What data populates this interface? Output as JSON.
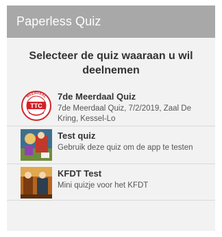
{
  "app_bar": {
    "title": "Paperless Quiz"
  },
  "heading": "Selecteer de quiz waaraan u wil deelnemen",
  "quizzes": [
    {
      "title": "7de Meerdaal Quiz",
      "description": "7de Meerdaal Quiz, 7/2/2019, Zaal De Kring, Kessel-Lo",
      "logo_text": "TTC",
      "logo_ring_text": "MEERDAAL"
    },
    {
      "title": "Test quiz",
      "description": "Gebruik deze quiz om de app te testen"
    },
    {
      "title": "KFDT Test",
      "description": "Mini quizje voor het KFDT"
    }
  ],
  "colors": {
    "app_bar": "#a8a8a8",
    "background": "#f2f2f2",
    "logo_red": "#d2232a"
  }
}
